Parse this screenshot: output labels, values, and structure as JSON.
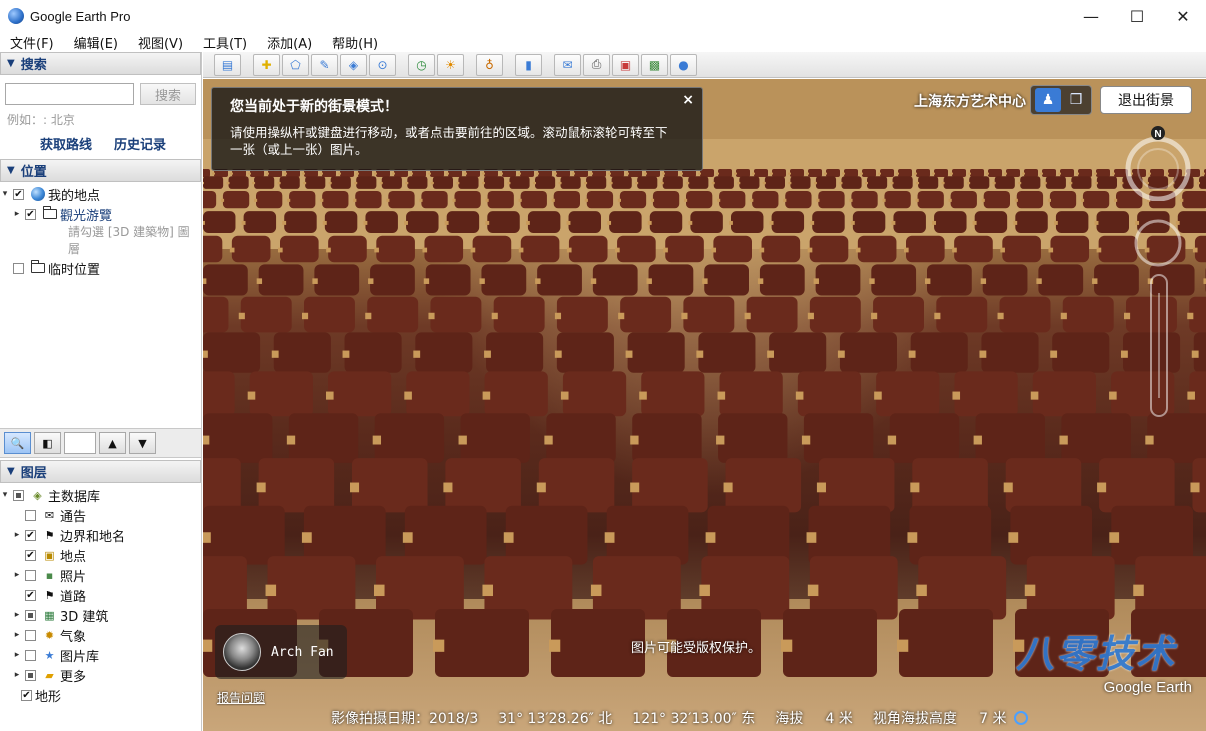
{
  "window": {
    "title": "Google Earth Pro",
    "minimize": "—",
    "maximize": "☐",
    "close": "✕"
  },
  "menu": [
    "文件(F)",
    "编辑(E)",
    "视图(V)",
    "工具(T)",
    "添加(A)",
    "帮助(H)"
  ],
  "search": {
    "header": "搜索",
    "input_value": "",
    "button": "搜索",
    "hint": "例如：: 北京",
    "link_directions": "获取路线",
    "link_history": "历史记录"
  },
  "places": {
    "header": "位置",
    "my_places": "我的地点",
    "tour_folder": "觀光游覽",
    "tour_hint": "請勾選 [3D 建築物] 圖層",
    "temp_places": "临时位置"
  },
  "layers": {
    "header": "图层",
    "primary_db": "主数据库",
    "items": [
      {
        "label": "通告",
        "checked": false
      },
      {
        "label": "边界和地名",
        "checked": true
      },
      {
        "label": "地点",
        "checked": true
      },
      {
        "label": "照片",
        "checked": false
      },
      {
        "label": "道路",
        "checked": true
      },
      {
        "label": "3D 建筑",
        "checked": "partial"
      },
      {
        "label": "气象",
        "checked": false
      },
      {
        "label": "图片库",
        "checked": false
      },
      {
        "label": "更多",
        "checked": "partial"
      },
      {
        "label": "地形",
        "checked": true
      }
    ]
  },
  "streetview": {
    "info_title": "您当前处于新的街景模式！",
    "info_body": "请使用操纵杆或键盘进行移动，或者点击要前往的区域。滚动鼠标滚轮可转至下一张（或上一张）图片。",
    "info_close": "×",
    "location_name": "上海东方艺术中心",
    "exit_label": "退出街景",
    "compass_north": "N",
    "user_name": "Arch Fan",
    "report_link": "报告问题",
    "copyright": "图片可能受版权保护。",
    "watermark": "八零技术",
    "ge_logo": "Google Earth"
  },
  "status": {
    "capture_date": "影像拍摄日期：2018/3",
    "lat": "31° 13′28.26″ 北",
    "lon": "121° 32′13.00″ 东",
    "elev": "海拔     4 米",
    "eye_alt": "视角海拔高度     7 米"
  },
  "colors": {
    "accent": "#1a3f7a",
    "sv_active": "#3a7bd5"
  }
}
